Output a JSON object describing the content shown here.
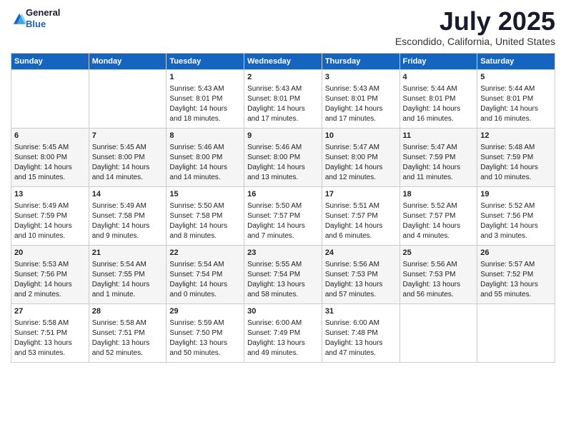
{
  "header": {
    "logo_general": "General",
    "logo_blue": "Blue",
    "month_title": "July 2025",
    "location": "Escondido, California, United States"
  },
  "calendar": {
    "days_of_week": [
      "Sunday",
      "Monday",
      "Tuesday",
      "Wednesday",
      "Thursday",
      "Friday",
      "Saturday"
    ],
    "weeks": [
      [
        {
          "day": "",
          "content": ""
        },
        {
          "day": "",
          "content": ""
        },
        {
          "day": "1",
          "content": "Sunrise: 5:43 AM\nSunset: 8:01 PM\nDaylight: 14 hours and 18 minutes."
        },
        {
          "day": "2",
          "content": "Sunrise: 5:43 AM\nSunset: 8:01 PM\nDaylight: 14 hours and 17 minutes."
        },
        {
          "day": "3",
          "content": "Sunrise: 5:43 AM\nSunset: 8:01 PM\nDaylight: 14 hours and 17 minutes."
        },
        {
          "day": "4",
          "content": "Sunrise: 5:44 AM\nSunset: 8:01 PM\nDaylight: 14 hours and 16 minutes."
        },
        {
          "day": "5",
          "content": "Sunrise: 5:44 AM\nSunset: 8:01 PM\nDaylight: 14 hours and 16 minutes."
        }
      ],
      [
        {
          "day": "6",
          "content": "Sunrise: 5:45 AM\nSunset: 8:00 PM\nDaylight: 14 hours and 15 minutes."
        },
        {
          "day": "7",
          "content": "Sunrise: 5:45 AM\nSunset: 8:00 PM\nDaylight: 14 hours and 14 minutes."
        },
        {
          "day": "8",
          "content": "Sunrise: 5:46 AM\nSunset: 8:00 PM\nDaylight: 14 hours and 14 minutes."
        },
        {
          "day": "9",
          "content": "Sunrise: 5:46 AM\nSunset: 8:00 PM\nDaylight: 14 hours and 13 minutes."
        },
        {
          "day": "10",
          "content": "Sunrise: 5:47 AM\nSunset: 8:00 PM\nDaylight: 14 hours and 12 minutes."
        },
        {
          "day": "11",
          "content": "Sunrise: 5:47 AM\nSunset: 7:59 PM\nDaylight: 14 hours and 11 minutes."
        },
        {
          "day": "12",
          "content": "Sunrise: 5:48 AM\nSunset: 7:59 PM\nDaylight: 14 hours and 10 minutes."
        }
      ],
      [
        {
          "day": "13",
          "content": "Sunrise: 5:49 AM\nSunset: 7:59 PM\nDaylight: 14 hours and 10 minutes."
        },
        {
          "day": "14",
          "content": "Sunrise: 5:49 AM\nSunset: 7:58 PM\nDaylight: 14 hours and 9 minutes."
        },
        {
          "day": "15",
          "content": "Sunrise: 5:50 AM\nSunset: 7:58 PM\nDaylight: 14 hours and 8 minutes."
        },
        {
          "day": "16",
          "content": "Sunrise: 5:50 AM\nSunset: 7:57 PM\nDaylight: 14 hours and 7 minutes."
        },
        {
          "day": "17",
          "content": "Sunrise: 5:51 AM\nSunset: 7:57 PM\nDaylight: 14 hours and 6 minutes."
        },
        {
          "day": "18",
          "content": "Sunrise: 5:52 AM\nSunset: 7:57 PM\nDaylight: 14 hours and 4 minutes."
        },
        {
          "day": "19",
          "content": "Sunrise: 5:52 AM\nSunset: 7:56 PM\nDaylight: 14 hours and 3 minutes."
        }
      ],
      [
        {
          "day": "20",
          "content": "Sunrise: 5:53 AM\nSunset: 7:56 PM\nDaylight: 14 hours and 2 minutes."
        },
        {
          "day": "21",
          "content": "Sunrise: 5:54 AM\nSunset: 7:55 PM\nDaylight: 14 hours and 1 minute."
        },
        {
          "day": "22",
          "content": "Sunrise: 5:54 AM\nSunset: 7:54 PM\nDaylight: 14 hours and 0 minutes."
        },
        {
          "day": "23",
          "content": "Sunrise: 5:55 AM\nSunset: 7:54 PM\nDaylight: 13 hours and 58 minutes."
        },
        {
          "day": "24",
          "content": "Sunrise: 5:56 AM\nSunset: 7:53 PM\nDaylight: 13 hours and 57 minutes."
        },
        {
          "day": "25",
          "content": "Sunrise: 5:56 AM\nSunset: 7:53 PM\nDaylight: 13 hours and 56 minutes."
        },
        {
          "day": "26",
          "content": "Sunrise: 5:57 AM\nSunset: 7:52 PM\nDaylight: 13 hours and 55 minutes."
        }
      ],
      [
        {
          "day": "27",
          "content": "Sunrise: 5:58 AM\nSunset: 7:51 PM\nDaylight: 13 hours and 53 minutes."
        },
        {
          "day": "28",
          "content": "Sunrise: 5:58 AM\nSunset: 7:51 PM\nDaylight: 13 hours and 52 minutes."
        },
        {
          "day": "29",
          "content": "Sunrise: 5:59 AM\nSunset: 7:50 PM\nDaylight: 13 hours and 50 minutes."
        },
        {
          "day": "30",
          "content": "Sunrise: 6:00 AM\nSunset: 7:49 PM\nDaylight: 13 hours and 49 minutes."
        },
        {
          "day": "31",
          "content": "Sunrise: 6:00 AM\nSunset: 7:48 PM\nDaylight: 13 hours and 47 minutes."
        },
        {
          "day": "",
          "content": ""
        },
        {
          "day": "",
          "content": ""
        }
      ]
    ]
  }
}
